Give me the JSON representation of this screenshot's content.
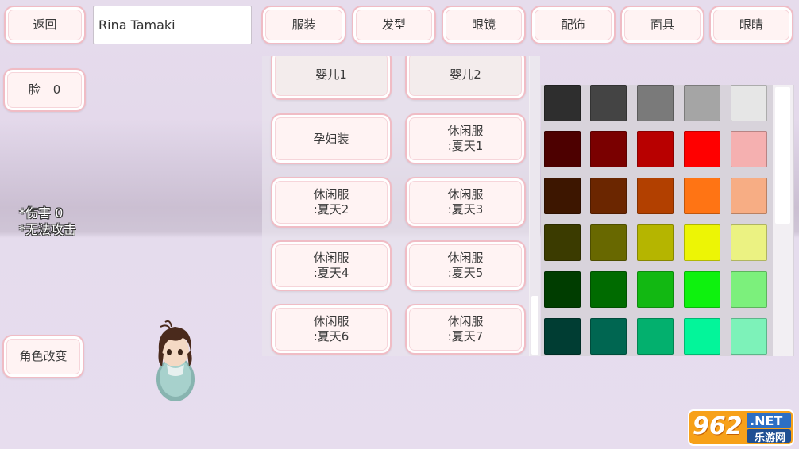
{
  "top_bar": {
    "back_label": "返回",
    "name_value": "Rina Tamaki",
    "tabs": [
      {
        "label": "服装"
      },
      {
        "label": "发型"
      },
      {
        "label": "眼镜"
      },
      {
        "label": "配饰"
      },
      {
        "label": "面具"
      },
      {
        "label": "眼睛"
      }
    ]
  },
  "face": {
    "label": "脸",
    "value": "0"
  },
  "status": {
    "line1": "*伤害 0",
    "line2": "*无法攻击"
  },
  "change_character_label": "角色改变",
  "outfits": [
    {
      "label": "婴儿1"
    },
    {
      "label": "婴儿2"
    },
    {
      "label": "孕妇装"
    },
    {
      "label": "休闲服\n:夏天1"
    },
    {
      "label": "休闲服\n:夏天2"
    },
    {
      "label": "休闲服\n:夏天3"
    },
    {
      "label": "休闲服\n:夏天4"
    },
    {
      "label": "休闲服\n:夏天5"
    },
    {
      "label": "休闲服\n:夏天6"
    },
    {
      "label": "休闲服\n:夏天7"
    }
  ],
  "palette": [
    [
      "#2e2e2e",
      "#444444",
      "#7a7a7a",
      "#a5a5a5",
      "#e6e6e6"
    ],
    [
      "#4d0000",
      "#7a0000",
      "#b80000",
      "#ff0000",
      "#f5b0b0"
    ],
    [
      "#3d1600",
      "#6b2600",
      "#b24000",
      "#ff7414",
      "#f7ad84"
    ],
    [
      "#3b3b00",
      "#686800",
      "#b5b500",
      "#edf505",
      "#ebf282"
    ],
    [
      "#003d00",
      "#006b00",
      "#12b812",
      "#0ef20e",
      "#7cf07c"
    ],
    [
      "#003d33",
      "#006651",
      "#03b06e",
      "#03f59a",
      "#7df2b9"
    ]
  ],
  "watermark": {
    "brand": "962",
    "suffix": ".NET",
    "tagline": "乐游网"
  }
}
